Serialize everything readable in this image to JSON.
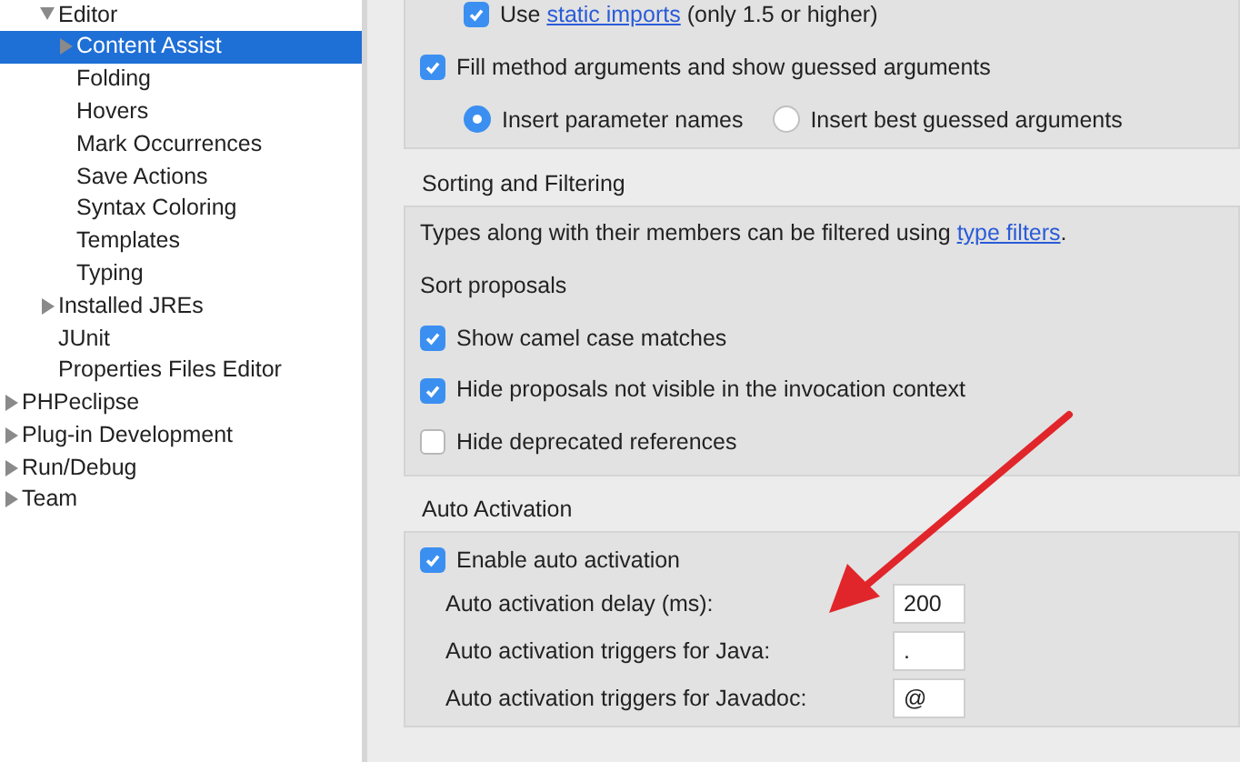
{
  "tree": [
    {
      "children": [
        {
          "label": "Editor",
          "expanded": true,
          "children": [
            {
              "label": "Content Assist",
              "selected": true,
              "expanded": false,
              "has_children": true
            },
            {
              "label": "Folding",
              "selected": false
            },
            {
              "label": "Hovers",
              "selected": false
            },
            {
              "label": "Mark Occurrences",
              "selected": false
            },
            {
              "label": "Save Actions",
              "selected": false
            },
            {
              "label": "Syntax Coloring",
              "selected": false
            },
            {
              "label": "Templates",
              "selected": false
            },
            {
              "label": "Typing",
              "selected": false
            }
          ]
        },
        {
          "label": "Installed JREs",
          "selected": false,
          "expanded": false,
          "has_children": true
        },
        {
          "label": "JUnit",
          "selected": false
        },
        {
          "label": "Properties Files Editor",
          "selected": false
        }
      ]
    },
    {
      "label": "PHPeclipse",
      "selected": false,
      "expanded": false,
      "has_children": true
    },
    {
      "label": "Plug-in Development",
      "selected": false,
      "expanded": false,
      "has_children": true
    },
    {
      "label": "Run/Debug",
      "selected": false,
      "expanded": false,
      "has_children": true
    },
    {
      "label": "Team",
      "selected": false,
      "expanded": false,
      "has_children": true
    }
  ],
  "insertion": {
    "static_imports": {
      "before": "Use",
      "link": "static imports",
      "after": "(only 1.5 or higher)",
      "checked": true
    },
    "fill_arguments": {
      "label": "Fill method arguments and show guessed arguments",
      "checked": true
    },
    "radios": [
      {
        "label": "Insert parameter names",
        "selected": true
      },
      {
        "label": "Insert best guessed arguments",
        "selected": false
      }
    ]
  },
  "sorting": {
    "title": "Sorting and Filtering",
    "note_before": "Types along with their members can be filtered using",
    "note_link": "type filters",
    "note_after": ".",
    "sort_label": "Sort proposals",
    "options": [
      {
        "label": "Show camel case matches",
        "checked": true
      },
      {
        "label": "Hide proposals not visible in the invocation context",
        "checked": true
      },
      {
        "label": "Hide deprecated references",
        "checked": false
      }
    ]
  },
  "auto_activation": {
    "title": "Auto Activation",
    "enable": {
      "label": "Enable auto activation",
      "checked": true
    },
    "fields": [
      {
        "label": "Auto activation delay (ms):",
        "value": "200"
      },
      {
        "label": "Auto activation triggers for Java:",
        "value": "."
      },
      {
        "label": "Auto activation triggers for Javadoc:",
        "value": "@"
      }
    ]
  }
}
